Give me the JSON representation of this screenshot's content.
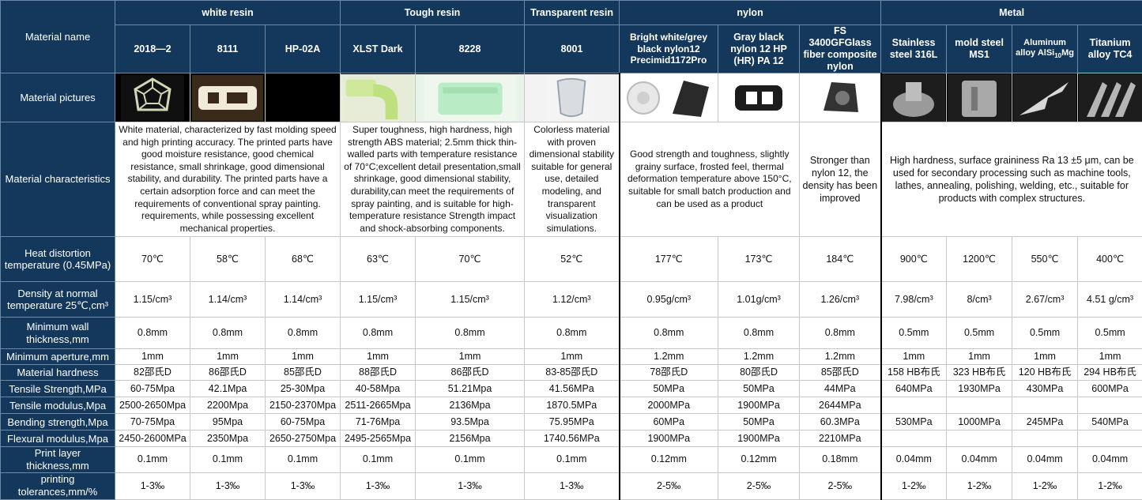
{
  "groups": {
    "white_resin": "white resin",
    "tough_resin": "Tough resin",
    "transparent_resin": "Transparent resin",
    "nylon": "nylon",
    "metal": "Metal"
  },
  "row_labels": {
    "material_name": "Material name",
    "material_pictures": "Material pictures",
    "material_characteristics": "Material characteristics",
    "heat_distortion": "Heat distortion temperature (0.45MPa)",
    "density": "Density at normal temperature 25℃,cm³",
    "min_wall": "Minimum wall thickness,mm",
    "min_aperture": "Minimum aperture,mm",
    "hardness": "Material hardness",
    "tensile_strength": "Tensile Strength,MPa",
    "tensile_modulus": "Tensile modulus,Mpa",
    "bending_strength": "Bending strength,Mpa",
    "flexural_modulus": "Flexural modulus,Mpa",
    "layer_thickness": "Print layer thickness,mm",
    "tolerances": "printing tolerances,mm/%"
  },
  "materials": [
    "2018—2",
    "8111",
    "HP-02A",
    "XLST Dark",
    "8228",
    "8001",
    "Bright white/grey black nylon12 Precimid1172Pro",
    "Gray black nylon 12 HP (HR) PA 12",
    "FS 3400GFGlass fiber composite nylon",
    "Stainless steel 316L",
    "mold steel MS1",
    "Aluminum alloy AlSi",
    "Titanium alloy TC4"
  ],
  "alsi_sub": "10",
  "alsi_suffix": "Mg",
  "characteristics": {
    "white_resin": "White material, characterized by fast molding speed and high printing accuracy. The printed parts have good moisture resistance, good chemical resistance, small shrinkage, good dimensional stability, and durability. The printed parts have a certain adsorption force and can meet the requirements of conventional spray painting. requirements, while possessing excellent mechanical properties.",
    "tough_resin": "Super toughness, high hardness, high strength ABS material; 2.5mm thick thin-walled parts with temperature resistance of 70°C;excellent detail presentation,small shrinkage, good dimensional stability, durability,can meet the requirements of spray painting, and is suitable for high-temperature resistance Strength impact and shock-absorbing components.",
    "transparent_resin": "Colorless material with proven dimensional stability suitable for general use, detailed modeling, and transparent visualization simulations.",
    "nylon12": "Good strength and toughness, slightly grainy surface, frosted feel, thermal deformation temperature above 150°C, suitable for small batch production and can be used as a product",
    "fs3400": "Stronger than nylon 12, the density has been improved",
    "metal": "High hardness, surface graininess Ra 13 ±5 μm, can be used for secondary processing such as machine tools, lathes, annealing, polishing, welding, etc., suitable for products with complex structures."
  },
  "heat": [
    "70℃",
    "58℃",
    "68℃",
    "63℃",
    "70℃",
    "52℃",
    "177℃",
    "173℃",
    "184℃",
    "900℃",
    "1200℃",
    "550℃",
    "400℃"
  ],
  "density": [
    "1.15/cm³",
    "1.14/cm³",
    "1.14/cm³",
    "1.15/cm³",
    "1.15/cm³",
    "1.12/cm³",
    "0.95g/cm³",
    "1.01g/cm³",
    "1.26/cm³",
    "7.98/cm³",
    "8/cm³",
    "2.67/cm³",
    "4.51 g/cm³"
  ],
  "min_wall": [
    "0.8mm",
    "0.8mm",
    "0.8mm",
    "0.8mm",
    "0.8mm",
    "0.8mm",
    "0.8mm",
    "0.8mm",
    "0.8mm",
    "0.5mm",
    "0.5mm",
    "0.5mm",
    "0.5mm"
  ],
  "min_aperture": [
    "1mm",
    "1mm",
    "1mm",
    "1mm",
    "1mm",
    "1mm",
    "1.2mm",
    "1.2mm",
    "1.2mm",
    "1mm",
    "1mm",
    "1mm",
    "1mm"
  ],
  "hardness": [
    "82邵氏D",
    "86邵氏D",
    "85邵氏D",
    "88邵氏D",
    "86邵氏D",
    "83-85邵氏D",
    "78邵氏D",
    "80邵氏D",
    "85邵氏D",
    "158 HB布氏",
    "323 HB布氏",
    "120 HB布氏",
    "294 HB布氏"
  ],
  "tensile_strength": [
    "60-75Mpa",
    "42.1Mpa",
    "25-30Mpa",
    "40-58Mpa",
    "51.21Mpa",
    "41.56MPa",
    "50MPa",
    "50MPa",
    "44MPa",
    "640MPa",
    "1930MPa",
    "430MPa",
    "600MPa"
  ],
  "tensile_modulus": [
    "2500-2650Mpa",
    "2200Mpa",
    "2150-2370Mpa",
    "2511-2665Mpa",
    "2136Mpa",
    "1870.5MPa",
    "2000MPa",
    "1900MPa",
    "2644MPa",
    "",
    "",
    "",
    ""
  ],
  "bending_strength": [
    "70-75Mpa",
    "95Mpa",
    "60-75Mpa",
    "71-76Mpa",
    "93.5Mpa",
    "75.95MPa",
    "60MPa",
    "50MPa",
    "60.3MPa",
    "530MPa",
    "1000MPa",
    "245MPa",
    "540MPa"
  ],
  "flexural_modulus": [
    "2450-2600MPa",
    "2350Mpa",
    "2650-2750Mpa",
    "2495-2565Mpa",
    "2156Mpa",
    "1740.56MPa",
    "1900MPa",
    "1900MPa",
    "2210MPa",
    "",
    "",
    "",
    ""
  ],
  "layer_thickness": [
    "0.1mm",
    "0.1mm",
    "0.1mm",
    "0.1mm",
    "0.1mm",
    "0.1mm",
    "0.12mm",
    "0.12mm",
    "0.18mm",
    "0.04mm",
    "0.04mm",
    "0.04mm",
    "0.04mm"
  ],
  "tolerances": [
    "1-3‰",
    "1-3‰",
    "1-3‰",
    "1-3‰",
    "1-3‰",
    "1-3‰",
    "2-5‰",
    "2-5‰",
    "2-5‰",
    "1-2‰",
    "1-2‰",
    "1-2‰",
    "1-2‰"
  ],
  "colors": {
    "header_bg": "#14385c",
    "header_text": "#ffffff",
    "picture_bg": "#000000"
  }
}
